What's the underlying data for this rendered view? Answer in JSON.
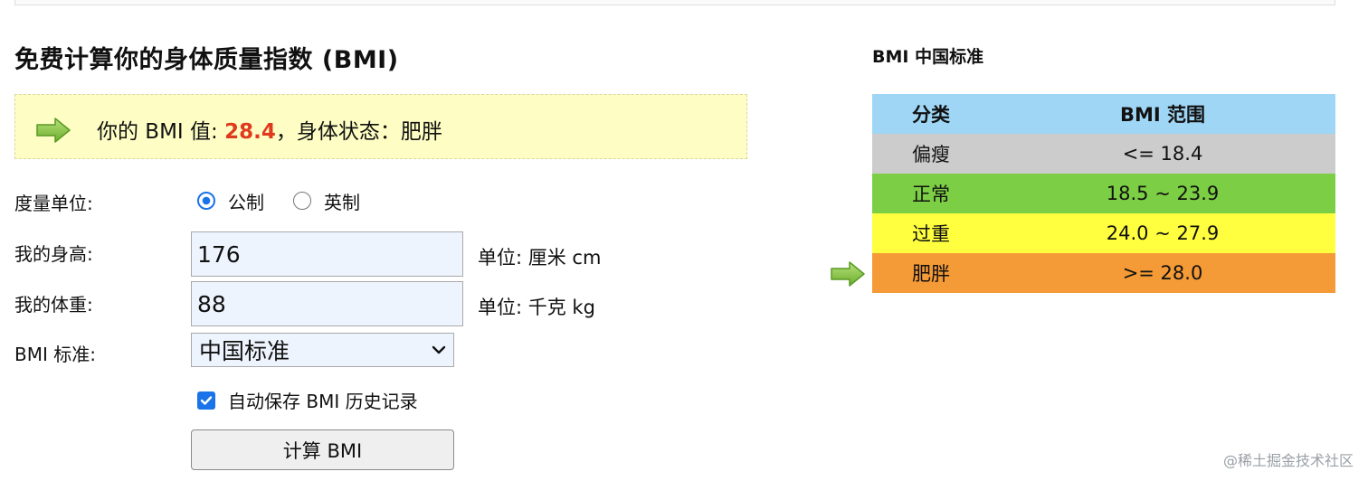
{
  "title": "免费计算你的身体质量指数 (BMI)",
  "result": {
    "prefix": "你的 BMI 值: ",
    "value": "28.4",
    "separator": "，",
    "status_label": "身体状态：",
    "status_value": "肥胖",
    "value_color": "#e03a1e",
    "box_color": "#fdfdc4"
  },
  "form": {
    "unit_label": "度量单位:",
    "unit_options": [
      {
        "label": "公制",
        "checked": true
      },
      {
        "label": "英制",
        "checked": false
      }
    ],
    "height_label": "我的身高:",
    "height_value": "176",
    "height_unit": "单位: 厘米 cm",
    "weight_label": "我的体重:",
    "weight_value": "88",
    "weight_unit": "单位: 千克 kg",
    "standard_label": "BMI 标准:",
    "standard_selected": "中国标准",
    "autosave_label": "自动保存 BMI 历史记录",
    "autosave_checked": true,
    "calculate_button": "计算 BMI"
  },
  "standard_table": {
    "title": "BMI 中国标准",
    "headers": [
      "分类",
      "BMI 范围"
    ],
    "header_color": "#9fd6f5",
    "rows": [
      {
        "category": "偏瘦",
        "range": "<= 18.4",
        "color": "#cccccc"
      },
      {
        "category": "正常",
        "range": "18.5 ~ 23.9",
        "color": "#7ccf44"
      },
      {
        "category": "过重",
        "range": "24.0 ~ 27.9",
        "color": "#ffff40"
      },
      {
        "category": "肥胖",
        "range": ">= 28.0",
        "color": "#f49a36",
        "current": true
      }
    ]
  },
  "icons": {
    "result_arrow": "arrow-right-icon",
    "table_arrow": "arrow-right-icon",
    "select_chevron": "chevron-down-icon"
  },
  "watermark": "@稀土掘金技术社区"
}
